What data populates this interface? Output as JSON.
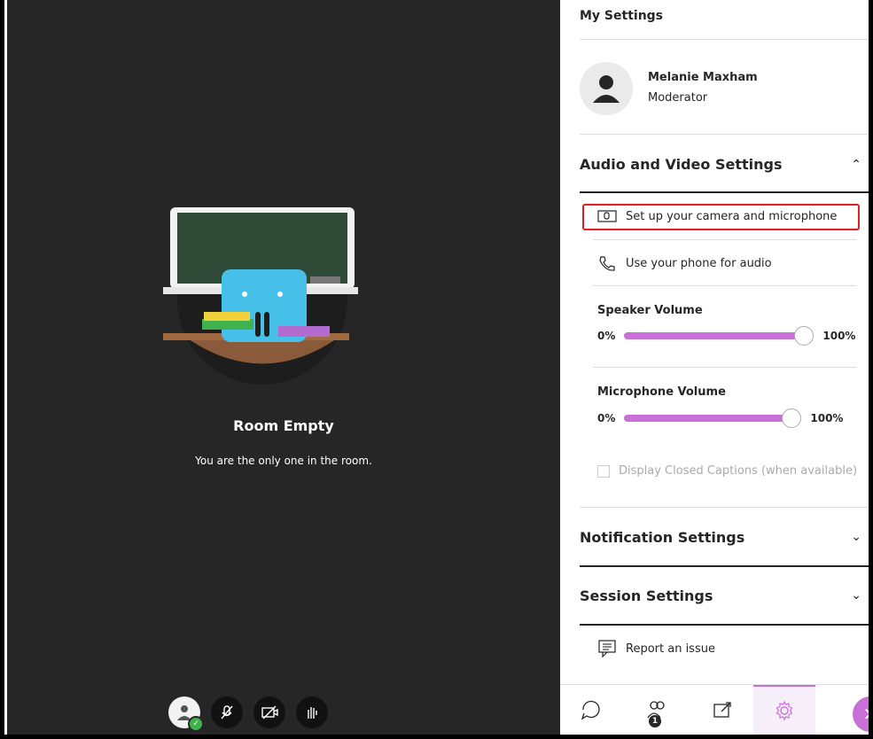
{
  "room": {
    "title": "Room Empty",
    "subtitle": "You are the only one in the room."
  },
  "panel": {
    "title": "My Settings",
    "user": {
      "name": "Melanie Maxham",
      "role": "Moderator"
    },
    "audio_video": {
      "title": "Audio and Video Settings",
      "camera_mic_label": "Set up your camera and microphone",
      "phone_label": "Use your phone for audio",
      "speaker": {
        "label": "Speaker Volume",
        "min": "0%",
        "max": "100%",
        "level": 1.0
      },
      "microphone": {
        "label": "Microphone Volume",
        "min": "0%",
        "max": "100%",
        "level": 1.0
      },
      "captions_label": "Display Closed Captions (when available)"
    },
    "notification_settings": "Notification Settings",
    "session_settings": "Session Settings",
    "report_issue": "Report an issue"
  },
  "bottom_tabs": {
    "attendees_badge": "1"
  },
  "colors": {
    "accent": "#c96fd8",
    "highlight_border": "#e02020",
    "stage_bg": "#262626"
  }
}
